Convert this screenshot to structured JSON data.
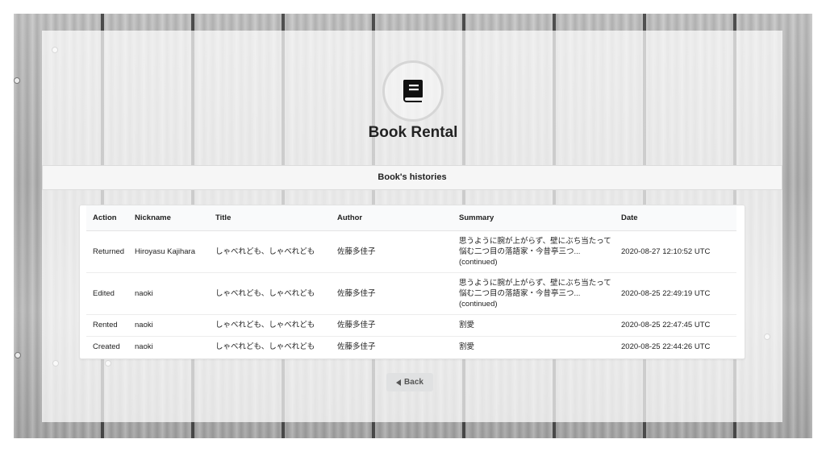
{
  "app": {
    "title": "Book Rental",
    "logo_icon": "book-icon"
  },
  "section": {
    "title": "Book's histories"
  },
  "table": {
    "headers": [
      "Action",
      "Nickname",
      "Title",
      "Author",
      "Summary",
      "Date"
    ],
    "rows": [
      {
        "action": "Returned",
        "nickname": "Hiroyasu Kajihara",
        "title": "しゃべれども、しゃべれども",
        "author": "佐藤多佳子",
        "summary_lines": [
          "思うように腕が上がらず、壁にぶち当たって",
          "悩む二つ目の落語家・今昔亭三つ...",
          "(continued)"
        ],
        "date": "2020-08-27 12:10:52 UTC"
      },
      {
        "action": "Edited",
        "nickname": "naoki",
        "title": "しゃべれども、しゃべれども",
        "author": "佐藤多佳子",
        "summary_lines": [
          "思うように腕が上がらず、壁にぶち当たって",
          "悩む二つ目の落語家・今昔亭三つ...",
          "(continued)"
        ],
        "date": "2020-08-25 22:49:19 UTC"
      },
      {
        "action": "Rented",
        "nickname": "naoki",
        "title": "しゃべれども、しゃべれども",
        "author": "佐藤多佳子",
        "summary_lines": [
          "割愛"
        ],
        "date": "2020-08-25 22:47:45 UTC"
      },
      {
        "action": "Created",
        "nickname": "naoki",
        "title": "しゃべれども、しゃべれども",
        "author": "佐藤多佳子",
        "summary_lines": [
          "割愛"
        ],
        "date": "2020-08-25 22:44:26 UTC"
      }
    ]
  },
  "back_button": {
    "label": "Back",
    "icon": "caret-left-icon"
  },
  "colors": {
    "text": "#222222",
    "button_bg": "#e0e1e2",
    "header_bg": "#f6f6f6"
  }
}
